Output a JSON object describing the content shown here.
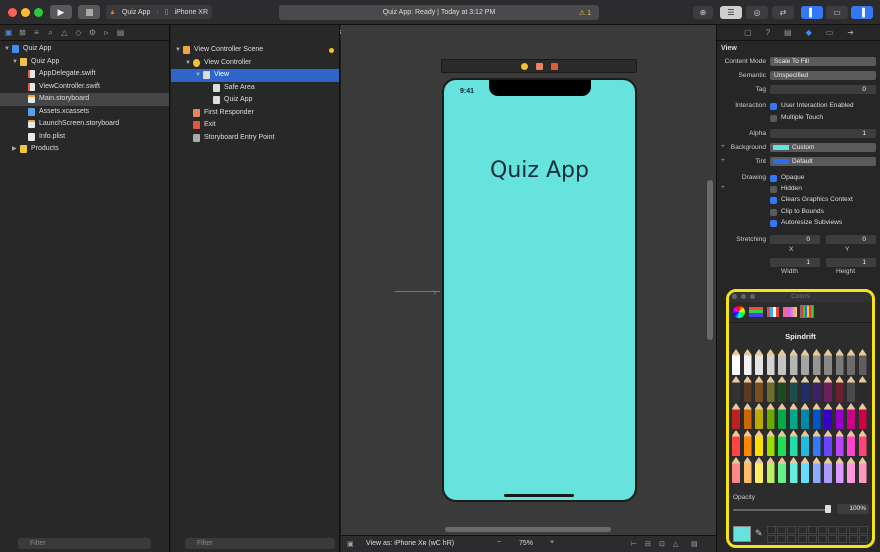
{
  "toolbar": {
    "scheme_app": "Quiz App",
    "scheme_device": "iPhone XR",
    "activity_text": "Quiz App: Ready | Today at 3:12 PM",
    "warning_count": "1"
  },
  "navigator": {
    "items": [
      {
        "label": "Quiz App",
        "kind": "project",
        "level": 0,
        "expanded": true
      },
      {
        "label": "Quiz App",
        "kind": "folder",
        "level": 1,
        "expanded": true
      },
      {
        "label": "AppDelegate.swift",
        "kind": "swift",
        "level": 2
      },
      {
        "label": "ViewController.swift",
        "kind": "swift",
        "level": 2
      },
      {
        "label": "Main.storyboard",
        "kind": "storyboard",
        "level": 2,
        "selected": true
      },
      {
        "label": "Assets.xcassets",
        "kind": "assets",
        "level": 2
      },
      {
        "label": "LaunchScreen.storyboard",
        "kind": "storyboard",
        "level": 2
      },
      {
        "label": "Info.plist",
        "kind": "plist",
        "level": 2
      },
      {
        "label": "Products",
        "kind": "folder",
        "level": 1,
        "expanded": false
      }
    ],
    "filter_placeholder": "Filter"
  },
  "jump_bar": [
    "Quiz App",
    "Quiz App",
    "Main.storyboard",
    "Main.sto...ard (Base)",
    "View Controller Scene",
    "View Controller",
    "View"
  ],
  "outline": {
    "items": [
      {
        "label": "View Controller Scene",
        "level": 0
      },
      {
        "label": "View Controller",
        "level": 1
      },
      {
        "label": "View",
        "level": 2,
        "selected": true
      },
      {
        "label": "Safe Area",
        "level": 3
      },
      {
        "label": "Quiz App",
        "level": 3
      },
      {
        "label": "First Responder",
        "level": 1
      },
      {
        "label": "Exit",
        "level": 1
      },
      {
        "label": "Storyboard Entry Point",
        "level": 1
      }
    ],
    "filter_placeholder": "Filter"
  },
  "canvas": {
    "device_time": "9:41",
    "label_text": "Quiz App",
    "view_as": "View as: iPhone Xʀ (wC hR)",
    "zoom": "75%",
    "background_color": "#66e3dd"
  },
  "inspector": {
    "title": "View",
    "content_mode_label": "Content Mode",
    "content_mode": "Scale To Fill",
    "semantic_label": "Semantic",
    "semantic": "Unspecified",
    "tag_label": "Tag",
    "tag": "0",
    "interaction_label": "Interaction",
    "user_interaction": "User Interaction Enabled",
    "multiple_touch": "Multiple Touch",
    "alpha_label": "Alpha",
    "alpha": "1",
    "background_label": "Background",
    "background": "Custom",
    "tint_label": "Tint",
    "tint": "Default",
    "drawing_label": "Drawing",
    "drawing": {
      "opaque": "Opaque",
      "hidden": "Hidden",
      "clears": "Clears Graphics Context",
      "clip": "Clip to Bounds",
      "autoresize": "Autoresize Subviews"
    },
    "stretching_label": "Stretching",
    "stretch_x": "0",
    "stretch_y": "0",
    "stretch_w": "1",
    "stretch_h": "1",
    "x_label": "X",
    "y_label": "Y",
    "width_label": "Width",
    "height_label": "Height"
  },
  "colors_panel": {
    "title": "Colors",
    "palette_name": "Spindrift",
    "opacity_label": "Opacity",
    "opacity_value": "100%",
    "selected_color": "#66e3dd"
  }
}
